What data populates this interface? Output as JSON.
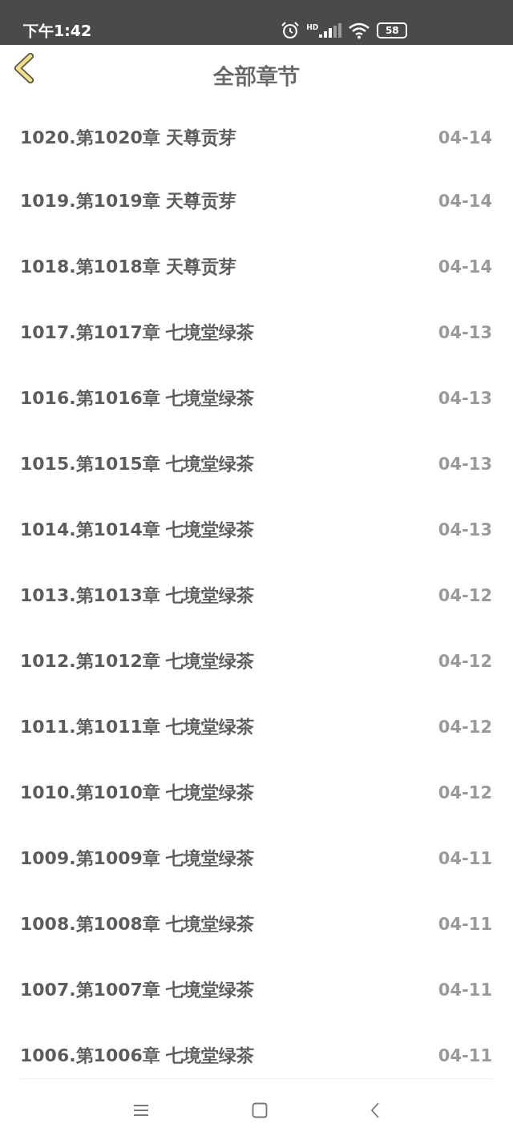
{
  "status_bar": {
    "time": "下午1:42",
    "network_label": "HD",
    "battery": "58"
  },
  "header": {
    "title": "全部章节"
  },
  "chapters": [
    {
      "title": "1020.第1020章 天尊贡芽",
      "date": "04-14"
    },
    {
      "title": "1019.第1019章 天尊贡芽",
      "date": "04-14"
    },
    {
      "title": "1018.第1018章 天尊贡芽",
      "date": "04-14"
    },
    {
      "title": "1017.第1017章 七境堂绿茶",
      "date": "04-13"
    },
    {
      "title": "1016.第1016章 七境堂绿茶",
      "date": "04-13"
    },
    {
      "title": "1015.第1015章 七境堂绿茶",
      "date": "04-13"
    },
    {
      "title": "1014.第1014章 七境堂绿茶",
      "date": "04-13"
    },
    {
      "title": "1013.第1013章 七境堂绿茶",
      "date": "04-12"
    },
    {
      "title": "1012.第1012章 七境堂绿茶",
      "date": "04-12"
    },
    {
      "title": "1011.第1011章 七境堂绿茶",
      "date": "04-12"
    },
    {
      "title": "1010.第1010章 七境堂绿茶",
      "date": "04-12"
    },
    {
      "title": "1009.第1009章 七境堂绿茶",
      "date": "04-11"
    },
    {
      "title": "1008.第1008章 七境堂绿茶",
      "date": "04-11"
    },
    {
      "title": "1007.第1007章 七境堂绿茶",
      "date": "04-11"
    },
    {
      "title": "1006.第1006章 七境堂绿茶",
      "date": "04-11"
    }
  ]
}
